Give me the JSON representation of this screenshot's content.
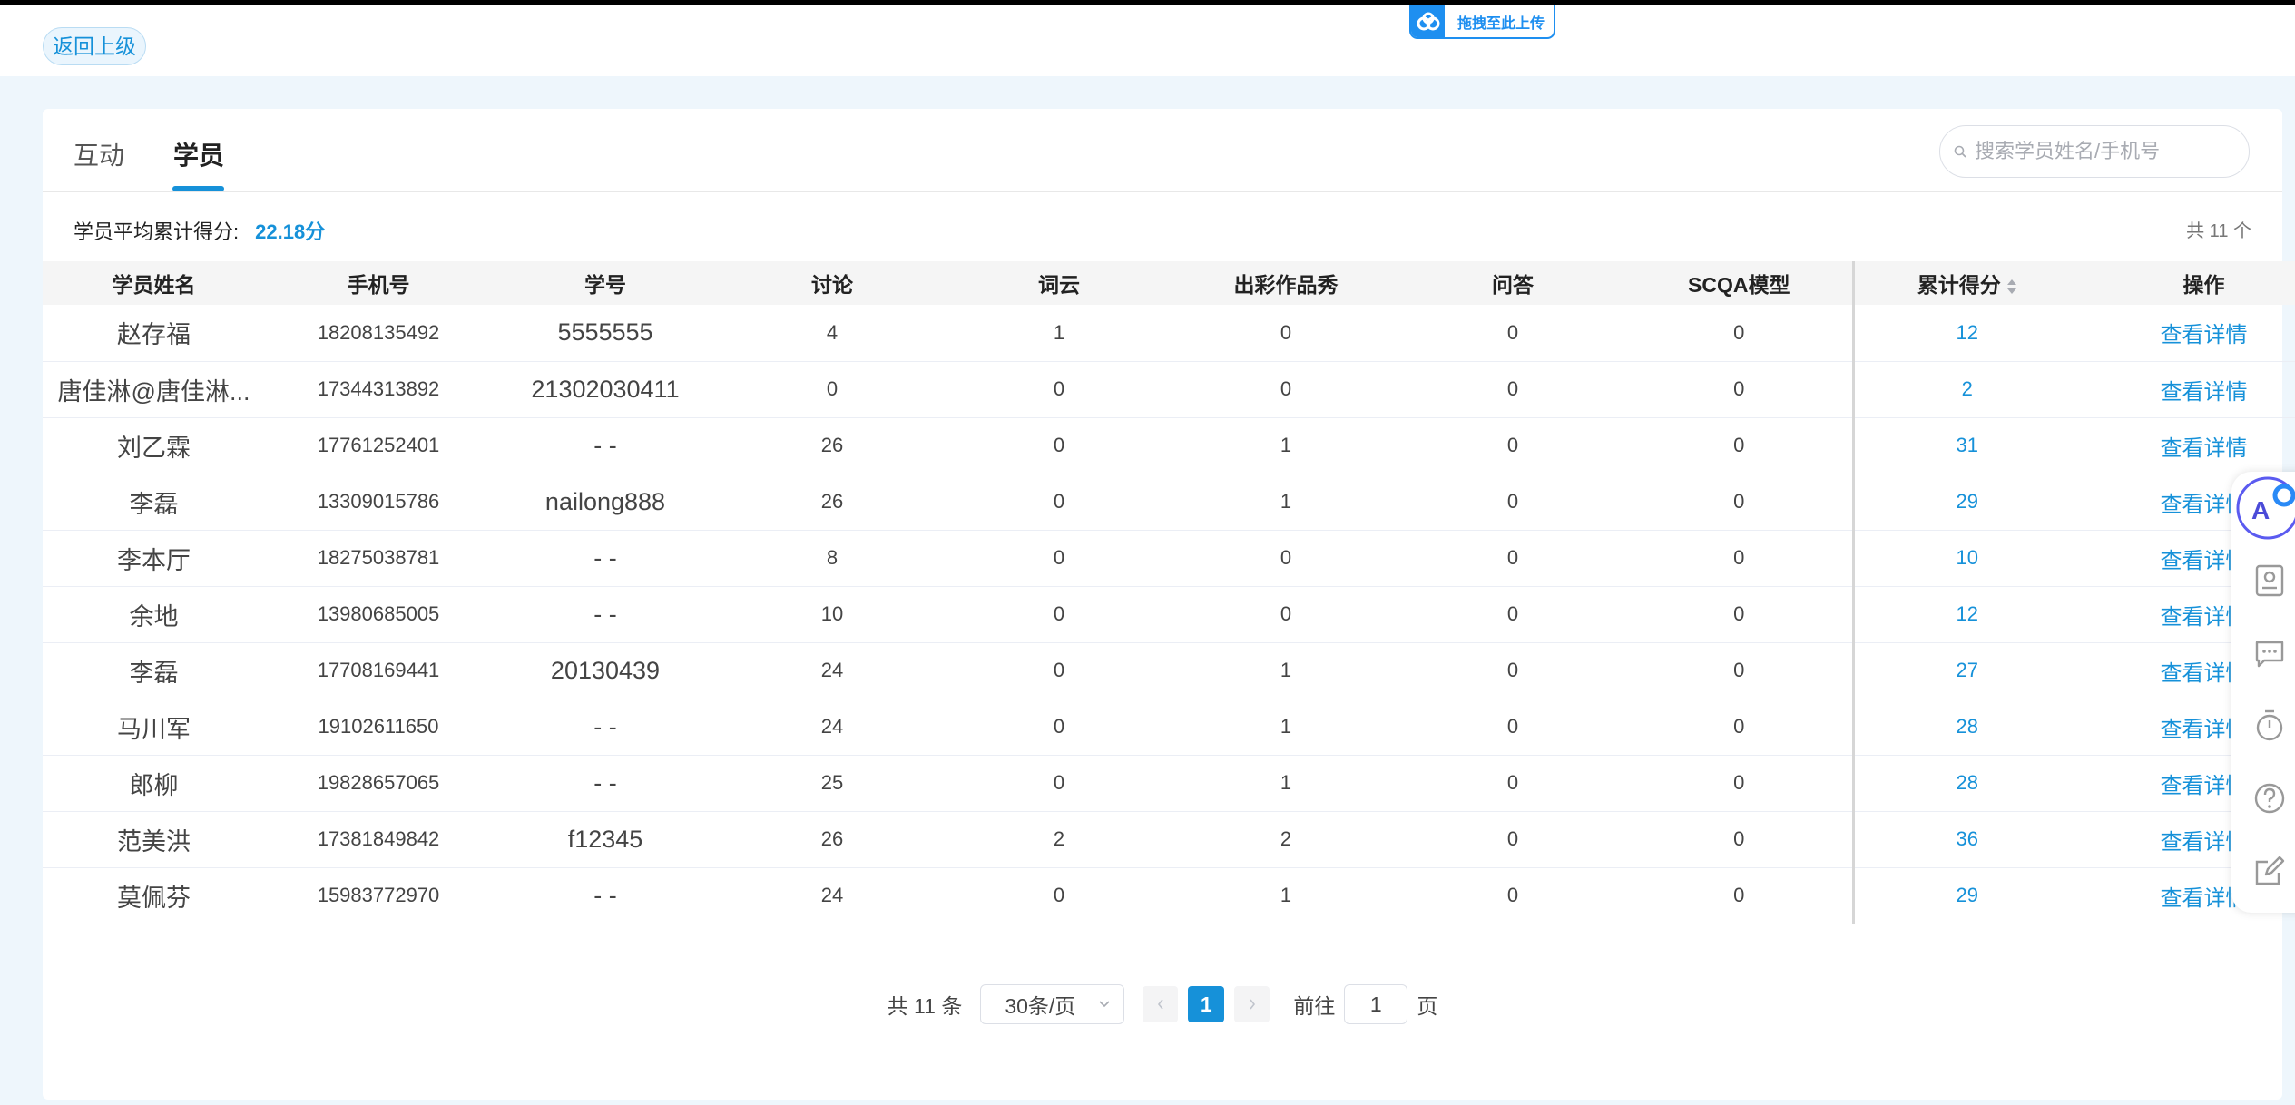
{
  "header": {
    "back_label": "返回上级",
    "upload_label": "拖拽至此上传"
  },
  "tabs": [
    {
      "label": "互动",
      "active": false
    },
    {
      "label": "学员",
      "active": true
    }
  ],
  "search": {
    "placeholder": "搜索学员姓名/手机号",
    "value": ""
  },
  "summary": {
    "avg_label": "学员平均累计得分:",
    "avg_value": "22.18分",
    "total_label": "共 11 个"
  },
  "table": {
    "columns": [
      "学员姓名",
      "手机号",
      "学号",
      "讨论",
      "词云",
      "出彩作品秀",
      "问答",
      "SCQA模型",
      "累计得分",
      "操作"
    ],
    "rows": [
      {
        "name": "赵存福",
        "phone": "18208135492",
        "sid": "5555555",
        "discussion": "4",
        "wordcloud": "1",
        "showcase": "0",
        "qa": "0",
        "scqa": "0",
        "score": "12",
        "action": "查看详情"
      },
      {
        "name": "唐佳淋@唐佳淋...",
        "phone": "17344313892",
        "sid": "21302030411",
        "discussion": "0",
        "wordcloud": "0",
        "showcase": "0",
        "qa": "0",
        "scqa": "0",
        "score": "2",
        "action": "查看详情"
      },
      {
        "name": "刘乙霖",
        "phone": "17761252401",
        "sid": "- -",
        "discussion": "26",
        "wordcloud": "0",
        "showcase": "1",
        "qa": "0",
        "scqa": "0",
        "score": "31",
        "action": "查看详情"
      },
      {
        "name": "李磊",
        "phone": "13309015786",
        "sid": "nailong888",
        "discussion": "26",
        "wordcloud": "0",
        "showcase": "1",
        "qa": "0",
        "scqa": "0",
        "score": "29",
        "action": "查看详情"
      },
      {
        "name": "李本厅",
        "phone": "18275038781",
        "sid": "- -",
        "discussion": "8",
        "wordcloud": "0",
        "showcase": "0",
        "qa": "0",
        "scqa": "0",
        "score": "10",
        "action": "查看详情"
      },
      {
        "name": "余地",
        "phone": "13980685005",
        "sid": "- -",
        "discussion": "10",
        "wordcloud": "0",
        "showcase": "0",
        "qa": "0",
        "scqa": "0",
        "score": "12",
        "action": "查看详情"
      },
      {
        "name": "李磊",
        "phone": "17708169441",
        "sid": "20130439",
        "discussion": "24",
        "wordcloud": "0",
        "showcase": "1",
        "qa": "0",
        "scqa": "0",
        "score": "27",
        "action": "查看详情"
      },
      {
        "name": "马川军",
        "phone": "19102611650",
        "sid": "- -",
        "discussion": "24",
        "wordcloud": "0",
        "showcase": "1",
        "qa": "0",
        "scqa": "0",
        "score": "28",
        "action": "查看详情"
      },
      {
        "name": "郎柳",
        "phone": "19828657065",
        "sid": "- -",
        "discussion": "25",
        "wordcloud": "0",
        "showcase": "1",
        "qa": "0",
        "scqa": "0",
        "score": "28",
        "action": "查看详情"
      },
      {
        "name": "范美洪",
        "phone": "17381849842",
        "sid": "f12345",
        "discussion": "26",
        "wordcloud": "2",
        "showcase": "2",
        "qa": "0",
        "scqa": "0",
        "score": "36",
        "action": "查看详情"
      },
      {
        "name": "莫佩芬",
        "phone": "15983772970",
        "sid": "- -",
        "discussion": "24",
        "wordcloud": "0",
        "showcase": "1",
        "qa": "0",
        "scqa": "0",
        "score": "29",
        "action": "查看详情"
      }
    ]
  },
  "pagination": {
    "total_label": "共 11 条",
    "page_size": "30条/页",
    "current_page": "1",
    "goto_label": "前往",
    "goto_value": "1",
    "page_suffix": "页"
  },
  "colors": {
    "accent": "#1691d9"
  },
  "floatbar_icons": [
    "ai-assistant-icon",
    "contact-card-icon",
    "chat-icon",
    "timer-icon",
    "help-icon",
    "edit-icon"
  ]
}
